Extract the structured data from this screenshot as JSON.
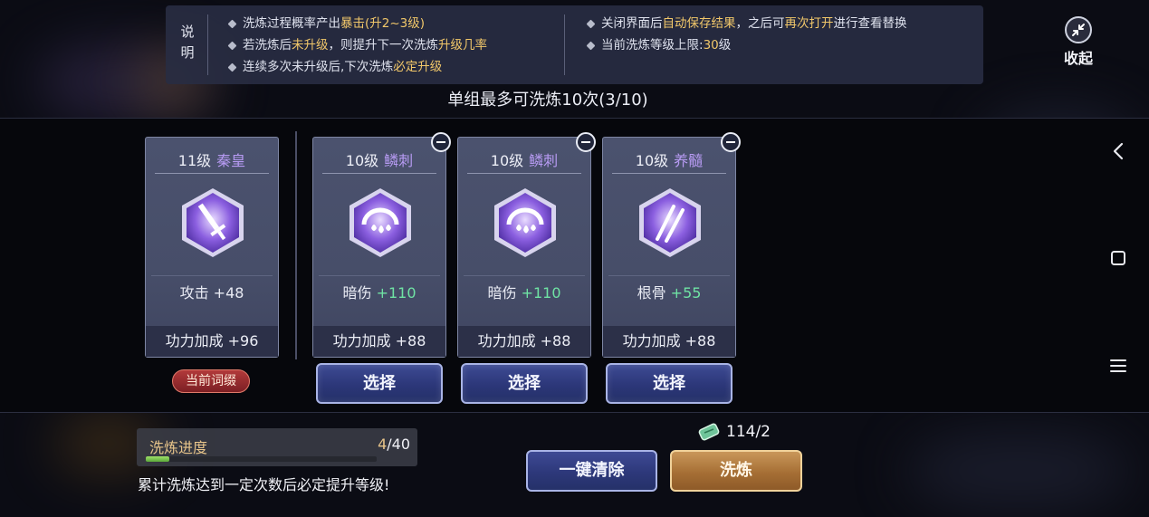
{
  "info": {
    "title": "说明",
    "col1": [
      {
        "pre": "洗炼过程概率产出",
        "hl": "暴击(升2~3级)",
        "post": ""
      },
      {
        "pre": "若洗炼后",
        "hl": "未升级",
        "post": "，则提升下一次洗炼",
        "hl2": "升级几率"
      },
      {
        "pre": "连续多次未升级后,下次洗炼",
        "hl": "必定升级",
        "post": ""
      }
    ],
    "col2": [
      {
        "pre": "关闭界面后",
        "hl": "自动保存结果",
        "post": "，之后可",
        "hl2": "再次打开",
        "post2": "进行查看替换"
      },
      {
        "pre": "当前洗炼等级上限:",
        "hl": "30",
        "post": "级"
      }
    ]
  },
  "collapse": {
    "label": "收起",
    "icon": "collapse-arrows-icon"
  },
  "subtitle": "单组最多可洗炼10次(3/10)",
  "current": {
    "level": "11级",
    "name": "秦皇",
    "icon": "sword-icon",
    "stat_name": "攻击",
    "stat_value": "+48",
    "power": "功力加成 +96",
    "badge": "当前词缀"
  },
  "options": [
    {
      "level": "10级",
      "name": "鳞刺",
      "icon": "drops-icon",
      "stat_name": "暗伤",
      "stat_value": "+110",
      "power": "功力加成 +88",
      "select": "选择"
    },
    {
      "level": "10级",
      "name": "鳞刺",
      "icon": "drops-icon",
      "stat_name": "暗伤",
      "stat_value": "+110",
      "power": "功力加成 +88",
      "select": "选择"
    },
    {
      "level": "10级",
      "name": "养髓",
      "icon": "slashes-icon",
      "stat_name": "根骨",
      "stat_value": "+55",
      "power": "功力加成 +88",
      "select": "选择"
    }
  ],
  "progress": {
    "label": "洗炼进度",
    "current": "4",
    "total": "/40",
    "fraction": 0.1,
    "note": "累计洗炼达到一定次数后必定提升等级!"
  },
  "cost": {
    "icon": "jade-token-icon",
    "value": "114/2"
  },
  "buttons": {
    "clear": "一键清除",
    "refine": "洗炼"
  },
  "colors": {
    "highlight": "#f1c76a",
    "stat_up": "#6fe3a4",
    "name_purple": "#b79bf3"
  }
}
